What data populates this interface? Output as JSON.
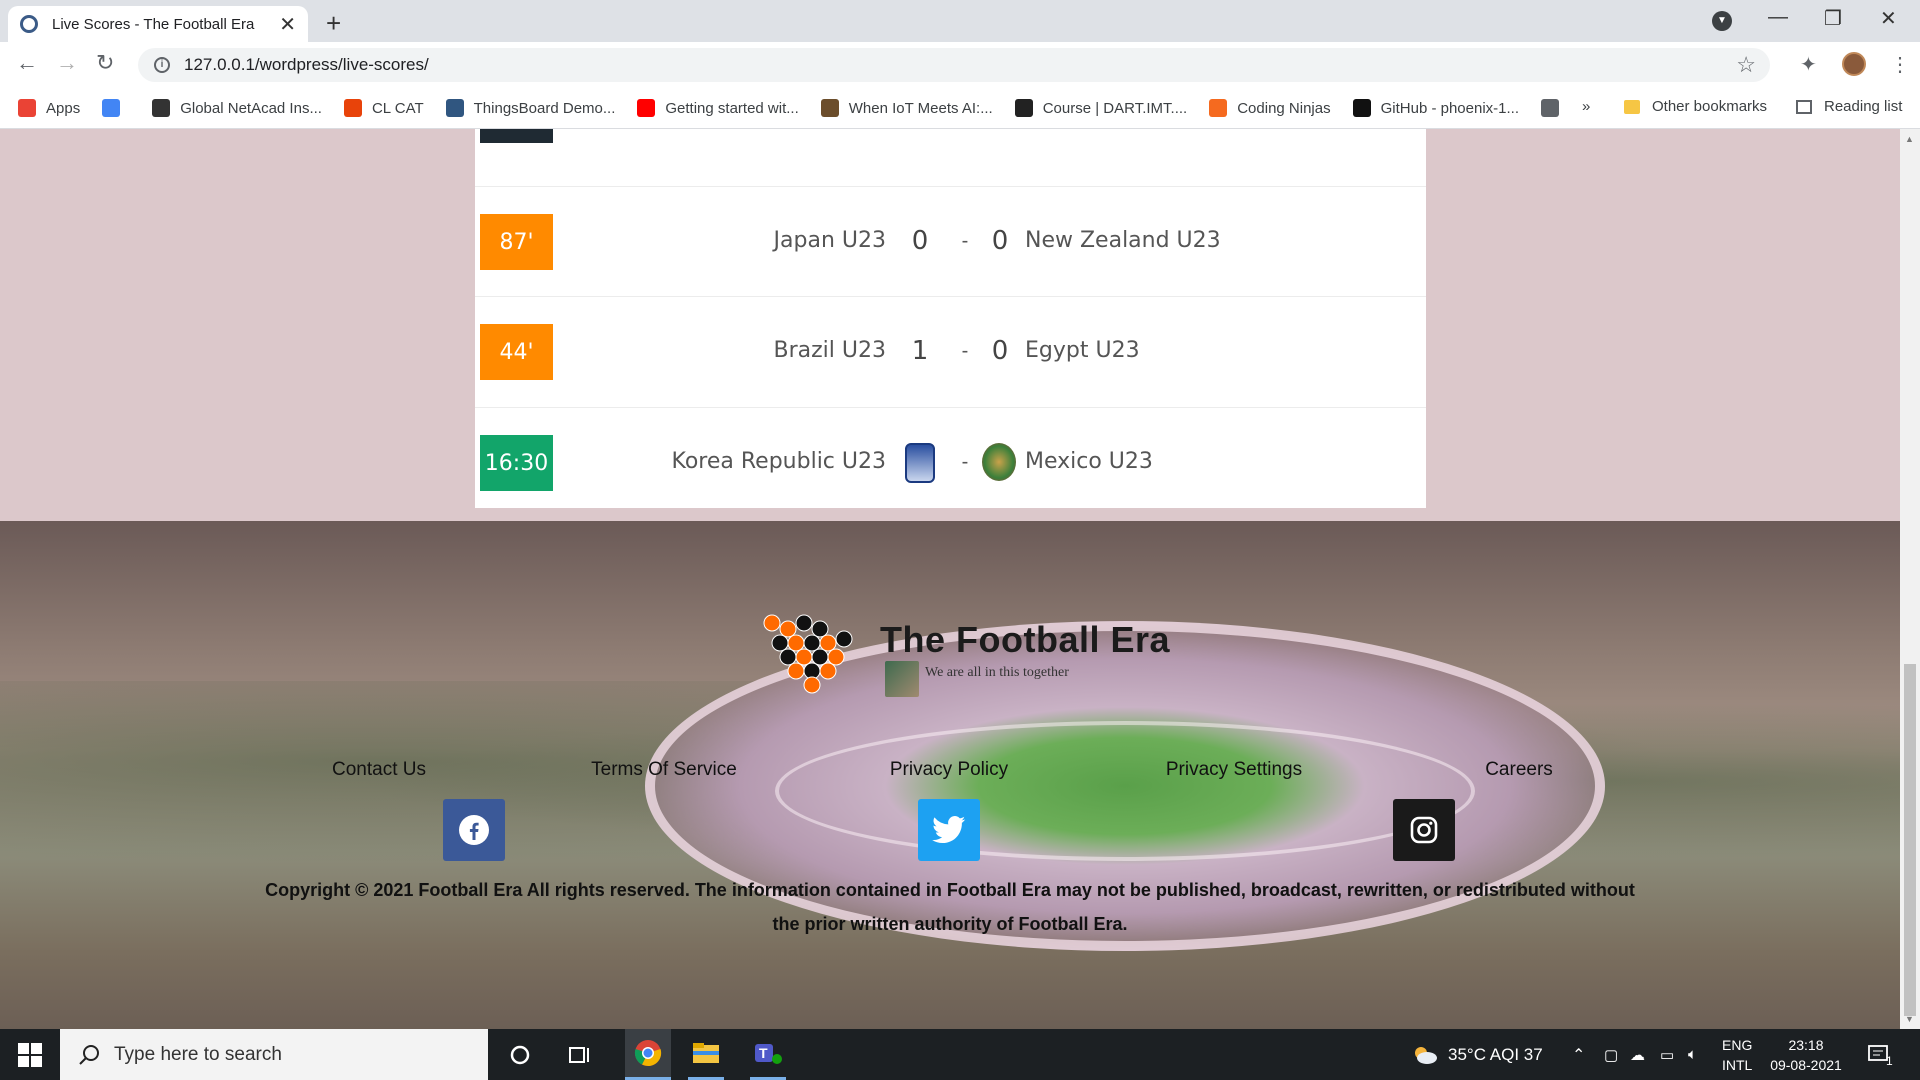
{
  "browser": {
    "tab_title": "Live Scores - The Football Era",
    "url": "127.0.0.1/wordpress/live-scores/",
    "bookmarks": [
      {
        "label": "Apps",
        "icon": "apps-grid-icon",
        "color": "#ea4335"
      },
      {
        "label": "",
        "icon": "google-icon",
        "color": "#4285f4"
      },
      {
        "label": "Global NetAcad Ins...",
        "icon": "cisco-icon",
        "color": "#333333"
      },
      {
        "label": "CL CAT",
        "icon": "ai-icon",
        "color": "#e8430a"
      },
      {
        "label": "ThingsBoard Demo...",
        "icon": "thingsboard-icon",
        "color": "#305680"
      },
      {
        "label": "Getting started wit...",
        "icon": "youtube-icon",
        "color": "#ff0000"
      },
      {
        "label": "When IoT Meets AI:...",
        "icon": "iot-icon",
        "color": "#6b4d2b"
      },
      {
        "label": "Course | DART.IMT....",
        "icon": "dart-icon",
        "color": "#222222"
      },
      {
        "label": "Coding Ninjas",
        "icon": "coding-ninjas-icon",
        "color": "#f56a1f"
      },
      {
        "label": "GitHub - phoenix-1...",
        "icon": "github-icon",
        "color": "#111111"
      },
      {
        "label": "",
        "icon": "globe-icon",
        "color": "#5f6368"
      }
    ],
    "overflow": "»",
    "other_bookmarks": "Other bookmarks",
    "reading_list": "Reading list"
  },
  "matches": [
    {
      "time": "",
      "status": "dark",
      "home": "",
      "home_score": "",
      "away": "",
      "away_score": "",
      "partial": true
    },
    {
      "time": "87'",
      "status": "live",
      "home": "Japan U23",
      "home_score": "0",
      "away": "New Zealand U23",
      "away_score": "0"
    },
    {
      "time": "44'",
      "status": "live",
      "home": "Brazil U23",
      "home_score": "1",
      "away": "Egypt U23",
      "away_score": "0"
    },
    {
      "time": "16:30",
      "status": "scheduled",
      "home": "Korea Republic U23",
      "home_score": "",
      "away": "Mexico U23",
      "away_score": ""
    }
  ],
  "separator": "-",
  "footer": {
    "logo_title": "The Football Era",
    "logo_tagline": "We are all in this together",
    "links": [
      "Contact Us",
      "Terms Of Service",
      "Privacy Policy",
      "Privacy Settings",
      "Careers"
    ],
    "social": [
      {
        "name": "facebook",
        "icon": "facebook-icon",
        "color": "#3b5998"
      },
      {
        "name": "twitter",
        "icon": "twitter-icon",
        "color": "#1da1f2"
      },
      {
        "name": "instagram",
        "icon": "instagram-icon",
        "color": "#1a1a1a"
      }
    ],
    "copyright": "Copyright © 2021 Football Era All rights reserved. The information contained in Football Era may not be published, broadcast, rewritten, or redistributed without the prior written authority of Football Era."
  },
  "taskbar": {
    "search_placeholder": "Type here to search",
    "weather": "35°C  AQI 37",
    "lang_top": "ENG",
    "lang_bottom": "INTL",
    "time": "23:18",
    "date": "09-08-2021",
    "notifications": "1"
  },
  "colors": {
    "live": "#ff8a00",
    "scheduled": "#12a56a",
    "accent": "#ff8a00"
  }
}
